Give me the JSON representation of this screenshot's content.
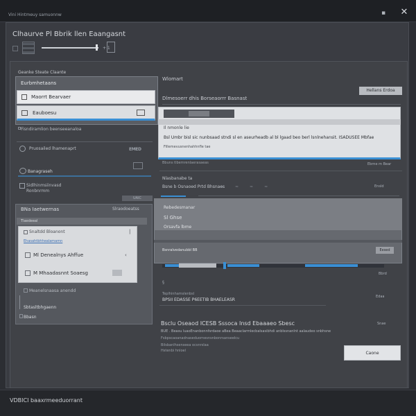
{
  "window": {
    "titlebar": "Vini Hintmeuy samuonnw",
    "minimize_glyph": "▪",
    "close_glyph": "✕"
  },
  "header": {
    "title": "Clhaurve Pl Bbrik llen Eaangasnt",
    "slider_value": "+ 1"
  },
  "left": {
    "caption": "Geanke Steate Claante",
    "box_title": "Eurbmhetaans",
    "row1_label": "Maorrt Bearvaer",
    "row2_label": "Eauboesu",
    "opt1": "Fisndiramlion beenseeanaloa",
    "opt2": "Pruosailed lhamenaprt",
    "opt2_badge": "EMED",
    "opt3": "Banagraseh",
    "opt4_line1": "Sidlhinmsiinvasd",
    "opt4_line2": "Ronbnrmm",
    "small_button": "UAIC"
  },
  "left2": {
    "title": "BNa Iaetwernas",
    "right": "Slraodoeatss",
    "bar": "Tlaedeeal",
    "p1": "Snaltdd Bloanont",
    "p1_right": "|",
    "p1_link": "Ehasahtbhhealamamn",
    "p2": "Ml Denealnys Ahffue",
    "p2_right": "‹",
    "p3": "M Mhaadasnnt Soaesg",
    "f1": "Meanelsnaasa anendd",
    "f2": "Sbtasltbhgaenn",
    "f3": "Bbasn"
  },
  "right": {
    "caption": "Wlomart",
    "top_button": "Hellans Erdoa",
    "description": "Dlmesoerr dhis Borseaorrr Basnast",
    "card_t1": "Il nmonle lie",
    "card_t2": "Bsl Umbr bisl sic nunbsaad stndi sl en aseurheadb al bl lgaad beo berl lsnlnehansit. ISADUSEE Mbfae",
    "card_t3": "Fillemevusnenhahhnfle tae",
    "note1": "Bbuns tlbemrenlaerasaeas",
    "note1_right": "Ebrne m Bear",
    "lbl1": "Nlasbanabe ta",
    "lbl2": "Bsne b Osnaoed Prtd Bhsnaes",
    "marks": "≈≈≈≈",
    "lbl2_right": "Ensld",
    "c2_t1": "Rebedesmanar",
    "c2_t2": "Sl Ghse",
    "c2_t3": "Orsavfa lbme",
    "c2_t4": "Bsnralvedanubbl BB",
    "c2_button": "Eesed",
    "prog_right": "Bbrd",
    "icon_s": "§",
    "lnk1": "Teplhinhamslenbsl",
    "lnk2": "BPSII EDASSE P6EETIB BHAELEASR",
    "lnk2_right": "Edaa",
    "h2": "Bsclu Oseaod ICESB Sssoca Insd Ebaaaeo Sbesc",
    "h2_right": "Snae",
    "d1": "BUE . Beasu luaoEnanbonnfsrdaoe aBea Beaaclarmlecbalsasibhdi anblssnanlnt aalaudeo snbhsne",
    "d2": "Fsbpscaoanadnaseduornesnsnbonrsanseelcu",
    "d3": "Bilsbanlhsenseea ocsnrslaa",
    "d4": "Hstenbi hnloel",
    "done_button": "Caone"
  },
  "footer": {
    "text": "VDBICI baaxrmeeduorrant"
  },
  "colors": {
    "accent": "#3a8fd4",
    "window_bg": "#3a3c42",
    "panel_bg": "#404247"
  },
  "icons": {
    "close": "close-icon",
    "minimize": "minimize-icon",
    "trash": "trash-icon"
  }
}
